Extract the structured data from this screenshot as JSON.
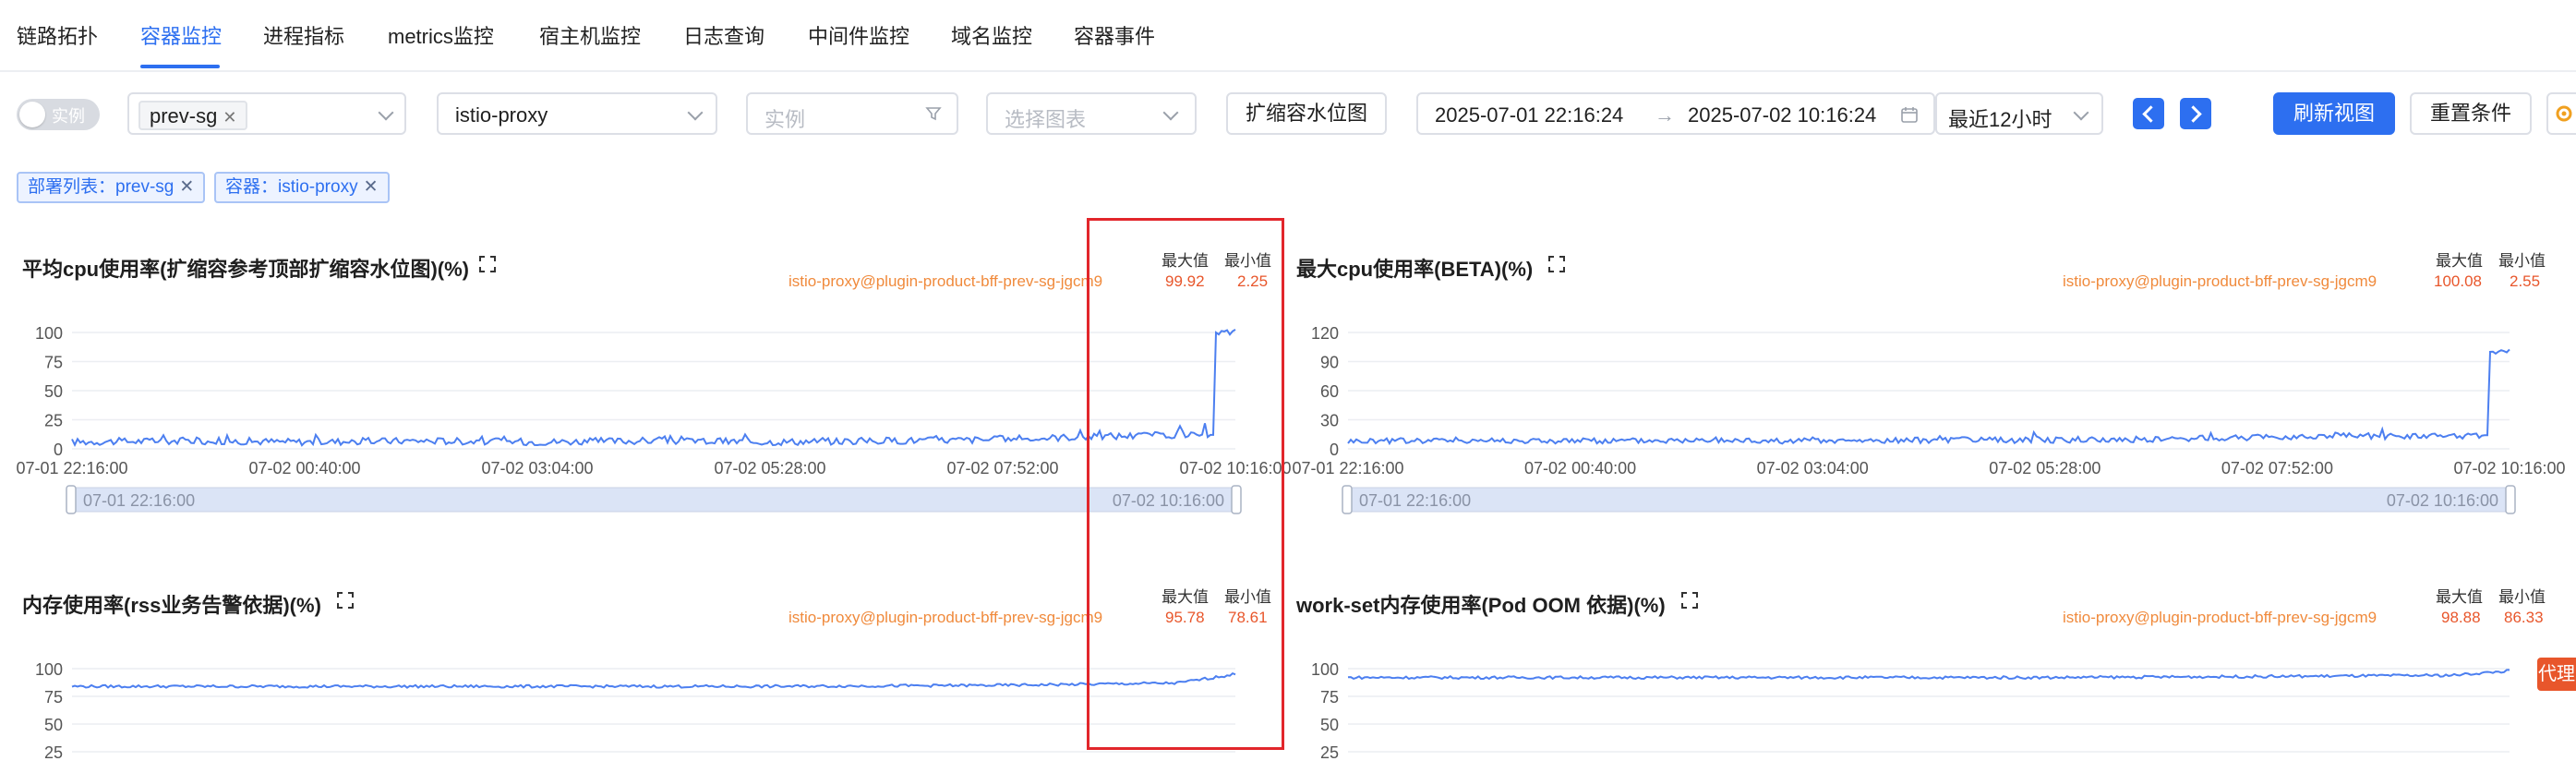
{
  "nav": {
    "tabs": [
      {
        "label": "链路拓扑"
      },
      {
        "label": "容器监控"
      },
      {
        "label": "进程指标"
      },
      {
        "label": "metrics监控"
      },
      {
        "label": "宿主机监控"
      },
      {
        "label": "日志查询"
      },
      {
        "label": "中间件监控"
      },
      {
        "label": "域名监控"
      },
      {
        "label": "容器事件"
      }
    ],
    "active_tab": "容器监控"
  },
  "filters": {
    "instance_toggle_label": "实例",
    "deployment_tag": "prev-sg",
    "container_value": "istio-proxy",
    "instance_placeholder": "实例",
    "chart_placeholder": "选择图表",
    "scale_button": "扩缩容水位图",
    "time_start": "2025-07-01 22:16:24",
    "time_end": "2025-07-02 10:16:24",
    "time_arrow": "→",
    "quick_range": "最近12小时",
    "refresh_button": "刷新视图",
    "reset_button": "重置条件"
  },
  "active_chips": [
    {
      "label": "部署列表：prev-sg"
    },
    {
      "label": "容器：istio-proxy"
    }
  ],
  "legend": {
    "max_label": "最大值",
    "min_label": "最小值"
  },
  "proxy_badge": "代理",
  "colors": {
    "accent": "#2d6ff0",
    "series_line": "#4c7ff0",
    "legend_value": "#e8562b",
    "legend_name": "#f08a3c",
    "highlight_box": "#e2262b"
  },
  "chart_data": [
    {
      "type": "line",
      "title": "平均cpu使用率(扩缩容参考顶部扩缩容水位图)(%)",
      "series": [
        {
          "name": "istio-proxy@plugin-product-bff-prev-sg-jgcm9",
          "max": "99.92",
          "min": "2.25"
        }
      ],
      "y_ticks": [
        "100",
        "75",
        "50",
        "25",
        "0"
      ],
      "ylim": [
        0,
        100
      ],
      "x_ticks": [
        "07-01 22:16:00",
        "07-02 00:40:00",
        "07-02 03:04:00",
        "07-02 05:28:00",
        "07-02 07:52:00",
        "07-02 10:16:00"
      ],
      "slider": {
        "start": "07-01 22:16:00",
        "end": "07-02 10:16:00"
      },
      "x": [
        "07-01 22:16",
        "07-01 23:28",
        "07-02 00:40",
        "07-02 01:52",
        "07-02 03:04",
        "07-02 04:16",
        "07-02 05:28",
        "07-02 06:40",
        "07-02 07:52",
        "07-02 08:30",
        "07-02 09:00",
        "07-02 09:40",
        "07-02 10:00",
        "07-02 10:05",
        "07-02 10:16"
      ],
      "values": [
        6,
        7,
        6,
        7,
        6,
        7,
        6,
        7,
        8,
        10,
        11,
        12,
        12,
        100,
        100
      ]
    },
    {
      "type": "line",
      "title": "最大cpu使用率(BETA)(%)",
      "series": [
        {
          "name": "istio-proxy@plugin-product-bff-prev-sg-jgcm9",
          "max": "100.08",
          "min": "2.55"
        }
      ],
      "y_ticks": [
        "120",
        "90",
        "60",
        "30",
        "0"
      ],
      "ylim": [
        0,
        120
      ],
      "x_ticks": [
        "07-01 22:16:00",
        "07-02 00:40:00",
        "07-02 03:04:00",
        "07-02 05:28:00",
        "07-02 07:52:00",
        "07-02 10:16:00"
      ],
      "slider": {
        "start": "07-01 22:16:00",
        "end": "07-02 10:16:00"
      },
      "x": [
        "07-01 22:16",
        "07-01 23:28",
        "07-02 00:40",
        "07-02 01:52",
        "07-02 03:04",
        "07-02 04:16",
        "07-02 05:28",
        "07-02 06:40",
        "07-02 07:52",
        "07-02 08:30",
        "07-02 09:00",
        "07-02 09:40",
        "07-02 10:00",
        "07-02 10:05",
        "07-02 10:16"
      ],
      "values": [
        8,
        9,
        8,
        9,
        8,
        9,
        9,
        10,
        12,
        14,
        13,
        13,
        14,
        100,
        100
      ]
    },
    {
      "type": "line",
      "title": "内存使用率(rss业务告警依据)(%)",
      "series": [
        {
          "name": "istio-proxy@plugin-product-bff-prev-sg-jgcm9",
          "max": "95.78",
          "min": "78.61"
        }
      ],
      "y_ticks": [
        "100",
        "75",
        "50",
        "25"
      ],
      "ylim": [
        0,
        100
      ],
      "x": [
        "07-01 22:16",
        "07-02 00:40",
        "07-02 03:04",
        "07-02 05:28",
        "07-02 07:52",
        "07-02 09:40",
        "07-02 10:16"
      ],
      "values": [
        84,
        84,
        84,
        84,
        85,
        87,
        95
      ]
    },
    {
      "type": "line",
      "title": "work-set内存使用率(Pod OOM 依据)(%)",
      "series": [
        {
          "name": "istio-proxy@plugin-product-bff-prev-sg-jgcm9",
          "max": "98.88",
          "min": "86.33"
        }
      ],
      "y_ticks": [
        "100",
        "75",
        "50",
        "25"
      ],
      "ylim": [
        0,
        100
      ],
      "x": [
        "07-01 22:16",
        "07-02 00:40",
        "07-02 03:04",
        "07-02 05:28",
        "07-02 07:52",
        "07-02 09:40",
        "07-02 10:16"
      ],
      "values": [
        92,
        92,
        92,
        92,
        93,
        94,
        98
      ]
    }
  ]
}
